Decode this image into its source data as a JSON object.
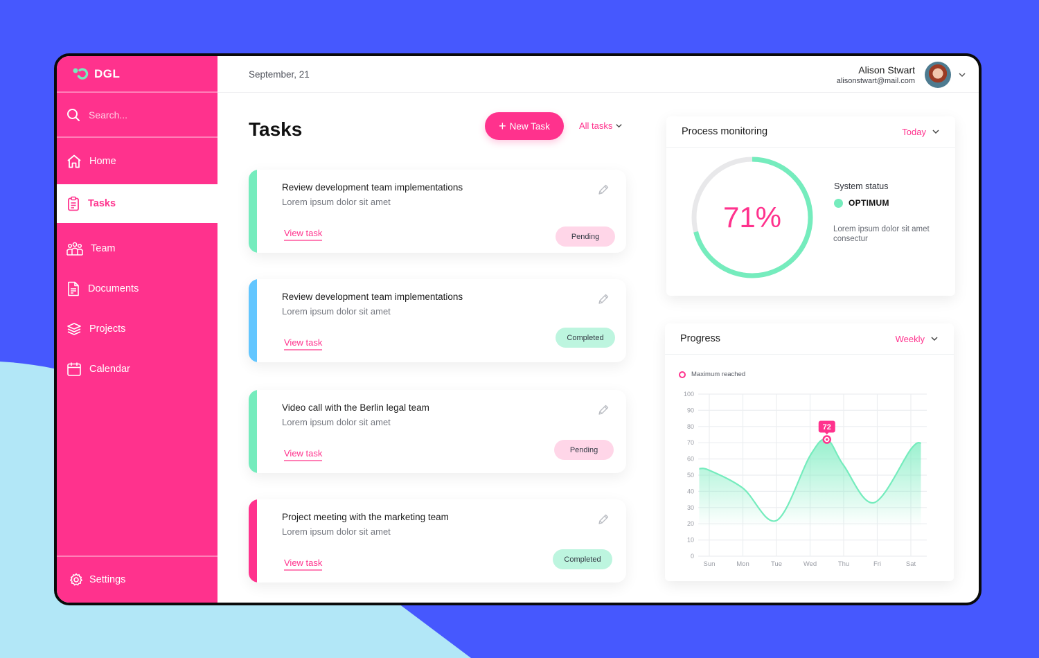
{
  "brand": {
    "name": "DGL",
    "colors": {
      "primary": "#ff328d",
      "accent": "#75ecbd",
      "background": "#4658fe",
      "light": "#b2e7f7"
    }
  },
  "search": {
    "placeholder": "Search..."
  },
  "sidebar": {
    "items": [
      {
        "label": "Home",
        "icon": "home-icon",
        "active": false
      },
      {
        "label": "Tasks",
        "icon": "clipboard-icon",
        "active": true
      },
      {
        "label": "Team",
        "icon": "team-icon",
        "active": false
      },
      {
        "label": "Documents",
        "icon": "document-icon",
        "active": false
      },
      {
        "label": "Projects",
        "icon": "layers-icon",
        "active": false
      },
      {
        "label": "Calendar",
        "icon": "calendar-icon",
        "active": false
      }
    ],
    "settings_label": "Settings"
  },
  "header": {
    "date": "September, 21",
    "user": {
      "name": "Alison Stwart",
      "email": "alisonstwart@mail.com"
    }
  },
  "tasks": {
    "title": "Tasks",
    "new_task_label": "New Task",
    "filter_label": "All tasks",
    "items": [
      {
        "title": "Review development team implementations",
        "subtitle": "Lorem ipsum dolor sit amet",
        "link": "View task",
        "status": "Pending",
        "accent": "#75ecbd"
      },
      {
        "title": "Review development team implementations",
        "subtitle": "Lorem ipsum dolor sit amet",
        "link": "View task",
        "status": "Completed",
        "accent": "#62c6ff"
      },
      {
        "title": "Video call with the Berlin legal team",
        "subtitle": "Lorem ipsum dolor sit amet",
        "link": "View task",
        "status": "Pending",
        "accent": "#75ecbd"
      },
      {
        "title": "Project meeting with the marketing team",
        "subtitle": "Lorem ipsum dolor sit amet",
        "link": "View task",
        "status": "Completed",
        "accent": "#ff328d"
      }
    ]
  },
  "process": {
    "title": "Process monitoring",
    "filter": "Today",
    "percent": 71,
    "percent_label": "71%",
    "status_label": "System status",
    "status_value": "OPTIMUM",
    "description": "Lorem ipsum dolor sit amet consectur"
  },
  "progress": {
    "title": "Progress",
    "filter": "Weekly"
  },
  "chart_data": {
    "type": "area",
    "title": "Progress",
    "legend": [
      "Maximum reached"
    ],
    "legend_position": "top-left",
    "categories": [
      "Sun",
      "Mon",
      "Tue",
      "Wed",
      "Thu",
      "Fri",
      "Sat"
    ],
    "y_ticks": [
      0,
      10,
      20,
      30,
      40,
      50,
      60,
      70,
      80,
      90,
      100
    ],
    "ylim": [
      0,
      100
    ],
    "grid": true,
    "series": [
      {
        "name": "Progress",
        "points": [
          {
            "x": -0.3,
            "y": 54
          },
          {
            "x": 0,
            "y": 53
          },
          {
            "x": 1,
            "y": 42
          },
          {
            "x": 2,
            "y": 22
          },
          {
            "x": 3,
            "y": 62
          },
          {
            "x": 3.5,
            "y": 72
          },
          {
            "x": 4,
            "y": 56
          },
          {
            "x": 4.9,
            "y": 33
          },
          {
            "x": 6,
            "y": 66
          },
          {
            "x": 6.3,
            "y": 70
          }
        ]
      }
    ],
    "annotation": {
      "label": "72",
      "x": 3.5,
      "y": 72
    }
  }
}
